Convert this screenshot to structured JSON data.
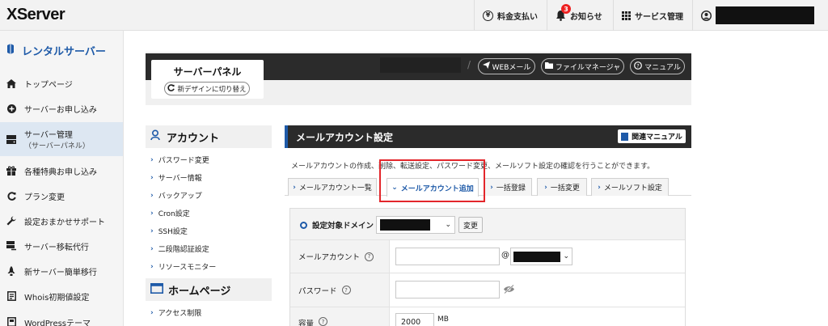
{
  "header": {
    "logo": "XServer",
    "nav": [
      {
        "label": "料金支払い",
        "icon": "yen-circle-icon"
      },
      {
        "label": "お知らせ",
        "icon": "bell-icon",
        "badge": "3"
      },
      {
        "label": "サービス管理",
        "icon": "grid-icon"
      }
    ]
  },
  "sidebar": {
    "title": "レンタルサーバー",
    "items": [
      {
        "label": "トップページ",
        "icon": "home-icon"
      },
      {
        "label": "サーバーお申し込み",
        "icon": "plus-circle-icon"
      },
      {
        "label": "サーバー管理",
        "sub": "（サーバーパネル）",
        "icon": "server-icon"
      },
      {
        "label": "各種特典お申し込み",
        "icon": "gift-icon"
      },
      {
        "label": "プラン変更",
        "icon": "refresh-icon"
      },
      {
        "label": "設定おまかせサポート",
        "icon": "wrench-icon"
      },
      {
        "label": "サーバー移転代行",
        "icon": "server-move-icon"
      },
      {
        "label": "新サーバー簡単移行",
        "icon": "rocket-icon"
      },
      {
        "label": "Whois初期値設定",
        "icon": "document-icon"
      },
      {
        "label": "WordPressテーマ",
        "icon": "theme-icon"
      }
    ]
  },
  "panel": {
    "title": "サーバーパネル",
    "switch_label": "新デザインに切り替え",
    "slash": "/",
    "links": [
      {
        "label": "WEBメール",
        "icon": "paper-plane-icon"
      },
      {
        "label": "ファイルマネージャ",
        "icon": "folder-icon"
      },
      {
        "label": "マニュアル",
        "icon": "question-circle-icon"
      }
    ]
  },
  "submenu": {
    "account_title": "アカウント",
    "account_items": [
      "パスワード変更",
      "サーバー情報",
      "バックアップ",
      "Cron設定",
      "SSH設定",
      "二段階認証設定",
      "リソースモニター"
    ],
    "homepage_title": "ホームページ",
    "homepage_items": [
      "アクセス制限"
    ]
  },
  "main": {
    "title": "メールアカウント設定",
    "manual_label": "関連マニュアル",
    "description": "メールアカウントの作成、削除、転送設定、パスワード変更、メールソフト設定の確認を行うことができます。",
    "tabs": [
      {
        "label": "メールアカウント一覧",
        "active": false
      },
      {
        "label": "メールアカウント追加",
        "active": true
      },
      {
        "label": "一括登録",
        "active": false
      },
      {
        "label": "一括変更",
        "active": false
      },
      {
        "label": "メールソフト設定",
        "active": false
      }
    ],
    "form": {
      "domain_label": "設定対象ドメイン",
      "change_label": "変更",
      "account_label": "メールアカウント",
      "at": "@",
      "password_label": "パスワード",
      "capacity_label": "容量",
      "capacity_value": "2000",
      "capacity_unit": "MB"
    }
  },
  "colors": {
    "accent": "#1e5aa8",
    "highlight": "#e3262b",
    "dark_bar": "#2b2b2b"
  }
}
